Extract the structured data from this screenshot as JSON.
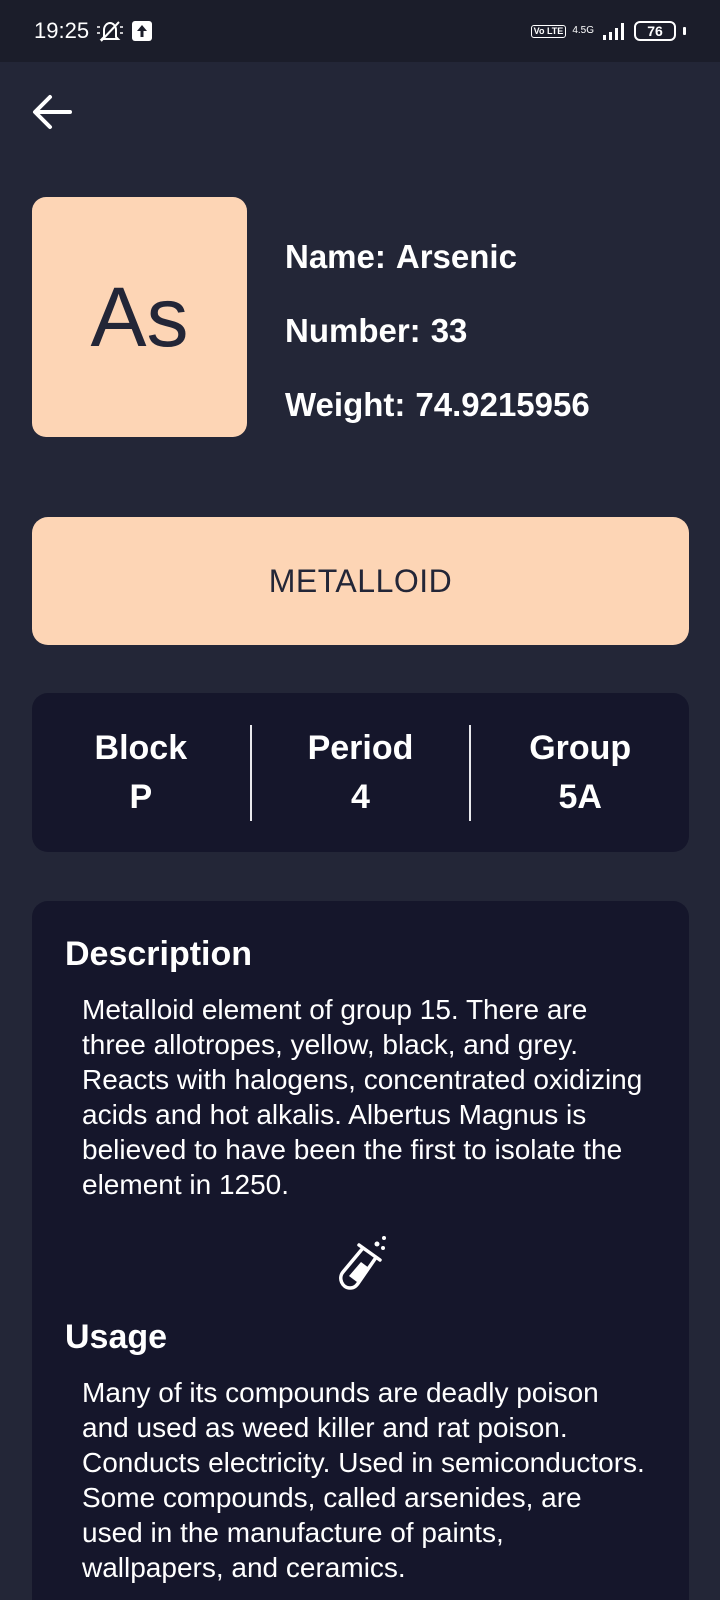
{
  "status_bar": {
    "time": "19:25",
    "network_label": "4.5G",
    "volte_label": "Vo LTE",
    "battery": "76"
  },
  "element": {
    "symbol": "As",
    "name_label": "Name:",
    "name": "Arsenic",
    "number_label": "Number:",
    "number": "33",
    "weight_label": "Weight:",
    "weight": "74.9215956",
    "category": "METALLOID"
  },
  "stats": {
    "block_label": "Block",
    "block": "P",
    "period_label": "Period",
    "period": "4",
    "group_label": "Group",
    "group": "5A"
  },
  "details": {
    "description_title": "Description",
    "description": "Metalloid element of group 15. There are three allotropes, yellow, black, and grey. Reacts with halogens, concentrated oxidizing acids and hot alkalis. Albertus Magnus is believed to have been the first to isolate the element in 1250.",
    "usage_title": "Usage",
    "usage": "Many of its compounds are deadly poison and used as weed killer and rat poison. Conducts electricity. Used in semiconductors. Some compounds, called arsenides, are used in the manufacture of paints, wallpapers, and ceramics."
  },
  "icons": [
    "mute-icon",
    "upload-icon",
    "volte-icon",
    "signal-icon",
    "battery-icon",
    "back-arrow-icon",
    "test-tube-icon"
  ],
  "colors": {
    "background": "#232637",
    "card": "#15162b",
    "accent": "#fdd5b5"
  }
}
